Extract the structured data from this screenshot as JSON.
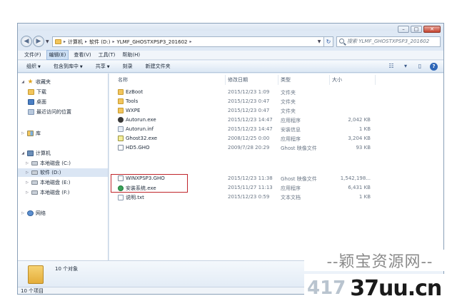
{
  "address": {
    "segments": [
      "计算机",
      "软件 (D:)",
      "YLMF_GHOSTXPSP3_201602"
    ],
    "search_placeholder": "搜索 YLMF_GHOSTXPSP3_201602"
  },
  "window_controls": {
    "minimize": "–",
    "maximize": "□",
    "close": "✕"
  },
  "menu": [
    "文件(F)",
    "编辑(E)",
    "查看(V)",
    "工具(T)",
    "帮助(H)"
  ],
  "menu_active_index": 1,
  "toolbar": {
    "organize": "组织",
    "add_to_library": "包含到库中",
    "share": "共享",
    "burn": "刻录",
    "new_folder": "新建文件夹"
  },
  "nav": {
    "favorites": "收藏夹",
    "downloads": "下载",
    "desktop": "桌面",
    "recent": "最近访问的位置",
    "libraries": "库",
    "computer": "计算机",
    "drive_c": "本地磁盘 (C:)",
    "drive_d": "软件 (D:)",
    "drive_e": "本地磁盘 (E:)",
    "drive_f": "本地磁盘 (F:)",
    "network": "网络"
  },
  "columns": {
    "name": "名称",
    "date": "修改日期",
    "type": "类型",
    "size": "大小"
  },
  "files": [
    {
      "name": "EzBoot",
      "date": "2015/12/23 1:09",
      "type": "文件夹",
      "size": "",
      "icon": "folder-icon"
    },
    {
      "name": "Tools",
      "date": "2015/12/23 0:47",
      "type": "文件夹",
      "size": "",
      "icon": "folder-icon"
    },
    {
      "name": "WXPE",
      "date": "2015/12/23 0:47",
      "type": "文件夹",
      "size": "",
      "icon": "folder-icon"
    },
    {
      "name": "Autorun.exe",
      "date": "2015/12/23 14:47",
      "type": "应用程序",
      "size": "2,042 KB",
      "icon": "exe-icon"
    },
    {
      "name": "Autorun.inf",
      "date": "2015/12/23 14:47",
      "type": "安装信息",
      "size": "1 KB",
      "icon": "inf-icon"
    },
    {
      "name": "Ghost32.exe",
      "date": "2008/12/25 0:00",
      "type": "应用程序",
      "size": "3,204 KB",
      "icon": "ghost-exe-icon"
    },
    {
      "name": "HD5.GHO",
      "date": "2009/7/28 20:29",
      "type": "Ghost 映像文件",
      "size": "93 KB",
      "icon": "ghost-file-icon"
    },
    {
      "name": "WINXPSP3.GHO",
      "date": "2015/12/23 11:38",
      "type": "Ghost 映像文件",
      "size": "1,542,198...",
      "icon": "ghost-file-icon"
    },
    {
      "name": "安装系统.exe",
      "date": "2015/11/27 11:13",
      "type": "应用程序",
      "size": "6,431 KB",
      "icon": "setup-icon"
    },
    {
      "name": "说明.txt",
      "date": "2015/12/23 0:59",
      "type": "文本文档",
      "size": "1 KB",
      "icon": "text-file-icon"
    }
  ],
  "details": {
    "count": "10 个对象"
  },
  "status": {
    "count": "10 个项目"
  },
  "watermark": {
    "line1": "--颖宝资源网--",
    "line2a": "417",
    "line2b": "37uu.cn"
  },
  "colors": {
    "highlight": "#c0262c",
    "folder": "#f2c55c",
    "accent": "#2f67b8"
  }
}
